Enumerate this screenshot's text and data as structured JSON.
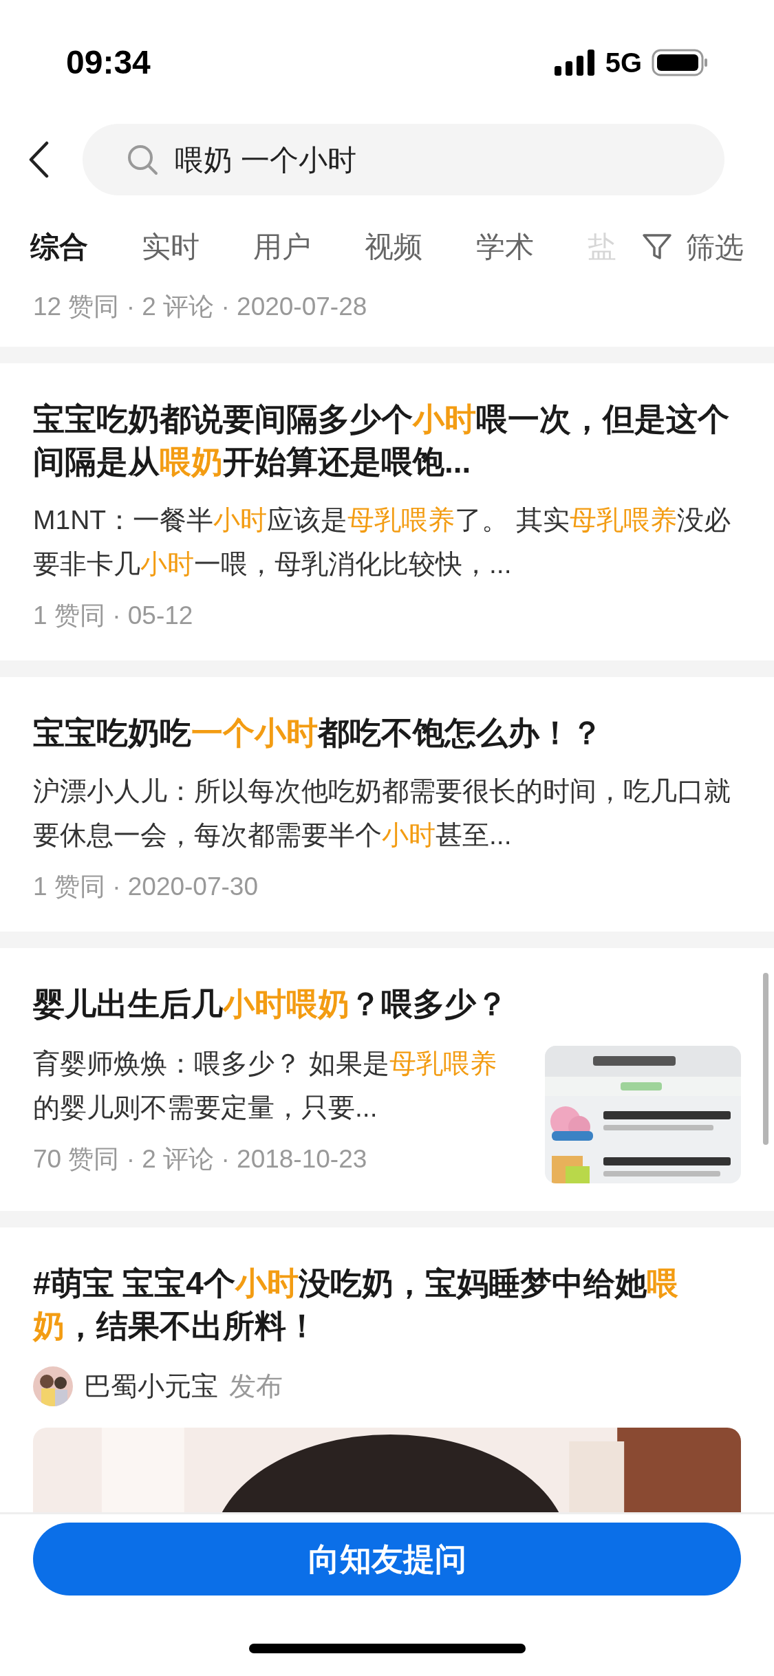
{
  "status_bar": {
    "time": "09:34",
    "network": "5G"
  },
  "search": {
    "value": "喂奶 一个小时"
  },
  "tabs": [
    {
      "label": "综合",
      "selected": true
    },
    {
      "label": "实时",
      "selected": false
    },
    {
      "label": "用户",
      "selected": false
    },
    {
      "label": "视频",
      "selected": false
    },
    {
      "label": "学术",
      "selected": false
    },
    {
      "label": "盐",
      "selected": false
    }
  ],
  "filter_label": "筛选",
  "partial_meta": "12 赞同 · 2 评论 · 2020-07-28",
  "results": [
    {
      "kind": "text",
      "title": [
        {
          "text": "宝宝吃奶都说要间隔多少个",
          "highlight": false
        },
        {
          "text": "小时",
          "highlight": true
        },
        {
          "text": "喂一次，但是这个间隔是从",
          "highlight": false
        },
        {
          "text": "喂奶",
          "highlight": true
        },
        {
          "text": "开始算还是喂饱...",
          "highlight": false
        }
      ],
      "excerpt": [
        {
          "text": "M1NT：一餐半",
          "highlight": false
        },
        {
          "text": "小时",
          "highlight": true
        },
        {
          "text": "应该是",
          "highlight": false
        },
        {
          "text": "母乳喂养",
          "highlight": true
        },
        {
          "text": "了。 其实",
          "highlight": false
        },
        {
          "text": "母乳喂养",
          "highlight": true
        },
        {
          "text": "没必要非卡几",
          "highlight": false
        },
        {
          "text": "小时",
          "highlight": true
        },
        {
          "text": "一喂，母乳消化比较快，...",
          "highlight": false
        }
      ],
      "meta": "1 赞同 · 05-12"
    },
    {
      "kind": "text",
      "title": [
        {
          "text": "宝宝吃奶吃",
          "highlight": false
        },
        {
          "text": "一个小时",
          "highlight": true
        },
        {
          "text": "都吃不饱怎么办！？",
          "highlight": false
        }
      ],
      "excerpt": [
        {
          "text": "沪漂小人儿：所以每次他吃奶都需要很长的时间，吃几口就要休息一会，每次都需要半个",
          "highlight": false
        },
        {
          "text": "小时",
          "highlight": true
        },
        {
          "text": "甚至...",
          "highlight": false
        }
      ],
      "meta": "1 赞同 · 2020-07-30"
    },
    {
      "kind": "thumbnail",
      "title": [
        {
          "text": "婴儿出生后几",
          "highlight": false
        },
        {
          "text": "小时喂奶",
          "highlight": true
        },
        {
          "text": "？喂多少？",
          "highlight": false
        }
      ],
      "excerpt": [
        {
          "text": "育婴师焕焕：喂多少？ 如果是",
          "highlight": false
        },
        {
          "text": "母乳喂养",
          "highlight": true
        },
        {
          "text": "的婴儿则不需要定量，只要...",
          "highlight": false
        }
      ],
      "meta": "70 赞同 · 2 评论 · 2018-10-23"
    },
    {
      "kind": "video",
      "title": [
        {
          "text": "#萌宝 宝宝4个",
          "highlight": false
        },
        {
          "text": "小时",
          "highlight": true
        },
        {
          "text": "没吃奶，宝妈睡梦中给她",
          "highlight": false
        },
        {
          "text": "喂奶",
          "highlight": true
        },
        {
          "text": "，结果不出所料！",
          "highlight": false
        }
      ],
      "author": "巴蜀小元宝",
      "author_action": "发布"
    }
  ],
  "ask_button": "向知友提问"
}
